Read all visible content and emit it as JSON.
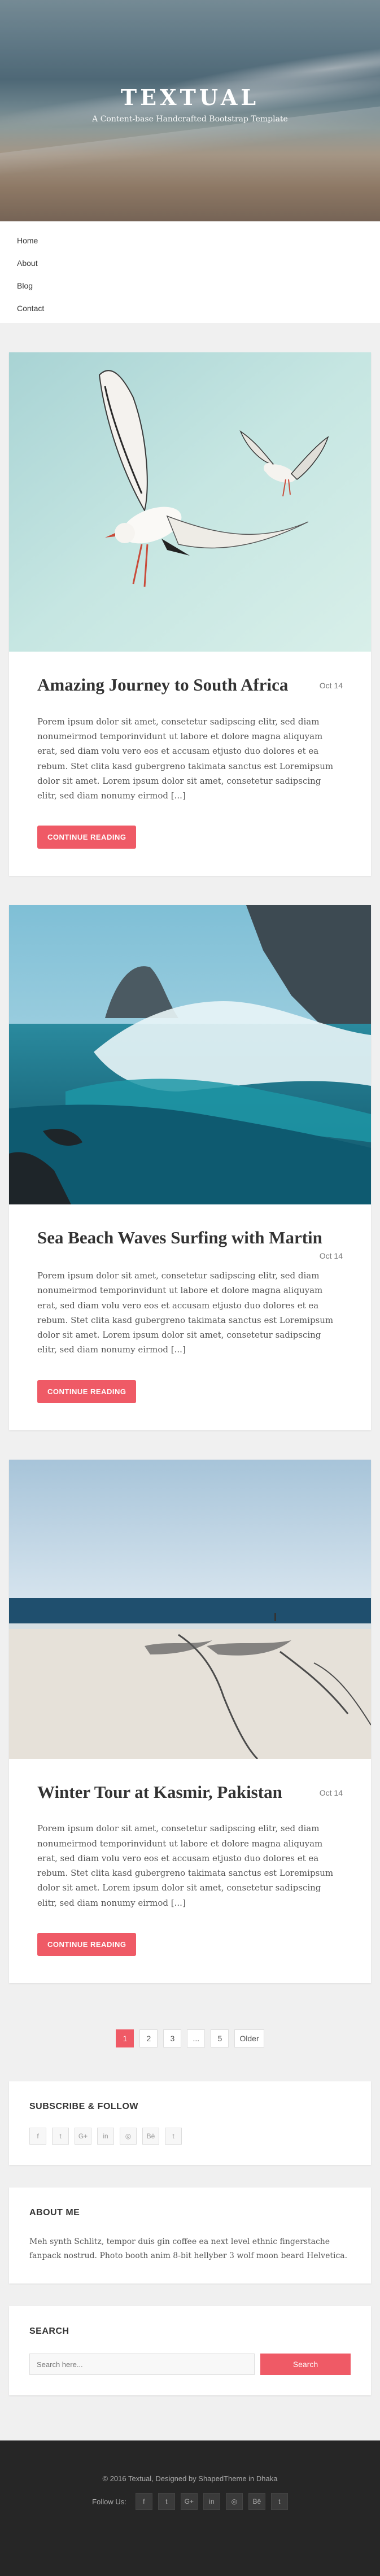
{
  "site": {
    "title": "TEXTUAL",
    "tagline": "A Content-base Handcrafted Bootstrap Template"
  },
  "nav": {
    "items": [
      {
        "label": "Home"
      },
      {
        "label": "About"
      },
      {
        "label": "Blog"
      },
      {
        "label": "Contact"
      }
    ]
  },
  "posts": [
    {
      "title": "Amazing Journey to South Africa",
      "date": "Oct 14",
      "excerpt": "Porem ipsum dolor sit amet, consetetur sadipscing elitr, sed diam nonumeirmod temporinvidunt ut labore et dolore magna aliquyam erat, sed diam volu vero eos et accusam etjusto duo dolores et ea rebum. Stet clita kasd gubergreno takimata sanctus est Loremipsum dolor sit amet. Lorem ipsum dolor sit amet, consetetur sadipscing elitr, sed diam nonumy eirmod [...]",
      "button": "CONTINUE READING"
    },
    {
      "title": "Sea Beach Waves Surfing with Martin",
      "date": "Oct 14",
      "excerpt": "Porem ipsum dolor sit amet, consetetur sadipscing elitr, sed diam nonumeirmod temporinvidunt ut labore et dolore magna aliquyam erat, sed diam volu vero eos et accusam etjusto duo dolores et ea rebum. Stet clita kasd gubergreno takimata sanctus est Loremipsum dolor sit amet. Lorem ipsum dolor sit amet, consetetur sadipscing elitr, sed diam nonumy eirmod [...]",
      "button": "CONTINUE READING"
    },
    {
      "title": "Winter Tour at Kasmir, Pakistan",
      "date": "Oct 14",
      "excerpt": "Porem ipsum dolor sit amet, consetetur sadipscing elitr, sed diam nonumeirmod temporinvidunt ut labore et dolore magna aliquyam erat, sed diam volu vero eos et accusam etjusto duo dolores et ea rebum. Stet clita kasd gubergreno takimata sanctus est Loremipsum dolor sit amet. Lorem ipsum dolor sit amet, consetetur sadipscing elitr, sed diam nonumy eirmod [...]",
      "button": "CONTINUE READING"
    }
  ],
  "pagination": {
    "pages": [
      "1",
      "2",
      "3",
      "...",
      "5"
    ],
    "active": "1",
    "older": "Older"
  },
  "widgets": {
    "subscribe_title": "SUBSCRIBE & FOLLOW",
    "social": [
      {
        "icon": "facebook-icon",
        "glyph": "f"
      },
      {
        "icon": "twitter-icon",
        "glyph": "t"
      },
      {
        "icon": "google-plus-icon",
        "glyph": "G+"
      },
      {
        "icon": "linkedin-icon",
        "glyph": "in"
      },
      {
        "icon": "instagram-icon",
        "glyph": "◎"
      },
      {
        "icon": "behance-icon",
        "glyph": "Bē"
      },
      {
        "icon": "tumblr-icon",
        "glyph": "t"
      }
    ],
    "about_title": "ABOUT ME",
    "about_text": "Meh synth Schlitz, tempor duis gin coffee ea next level ethnic fingerstache fanpack nostrud. Photo booth anim 8-bit hellyber 3 wolf moon beard Helvetica.",
    "search_title": "SEARCH",
    "search_placeholder": "Search here...",
    "search_button": "Search"
  },
  "footer": {
    "copyright": "© 2016 Textual, Designed by ShapedTheme in Dhaka",
    "follow_label": "Follow Us:",
    "social": [
      {
        "icon": "facebook-icon",
        "glyph": "f"
      },
      {
        "icon": "twitter-icon",
        "glyph": "t"
      },
      {
        "icon": "google-plus-icon",
        "glyph": "G+"
      },
      {
        "icon": "linkedin-icon",
        "glyph": "in"
      },
      {
        "icon": "instagram-icon",
        "glyph": "◎"
      },
      {
        "icon": "behance-icon",
        "glyph": "Bē"
      },
      {
        "icon": "tumblr-icon",
        "glyph": "t"
      }
    ]
  },
  "colors": {
    "accent": "#ef5a66",
    "footer_bg": "#262626",
    "page_bg": "#f0f0f0"
  }
}
